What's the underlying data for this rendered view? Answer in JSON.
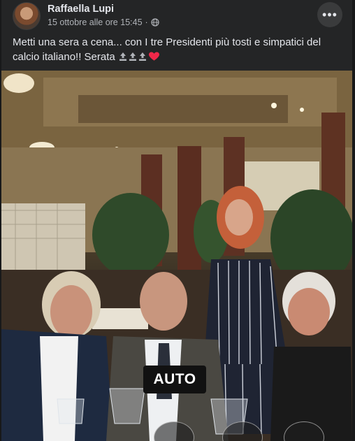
{
  "post": {
    "author": "Raffaella Lupi",
    "timestamp": "15 ottobre alle ore 15:45",
    "audience_icon": "globe-icon",
    "more_icon": "more-options-icon",
    "more_label": "•••",
    "caption_line1": "Metti una sera a cena... con I tre Presidenti più tosti e simpatici  del",
    "caption_line2_prefix": "calcio italiano!! Serata",
    "caption_emojis": [
      "top-arrow-emoji",
      "top-arrow-emoji",
      "top-arrow-emoji",
      "red-heart-emoji"
    ],
    "heart_color": "#f02849"
  },
  "photo": {
    "auto_label": "AUTO"
  },
  "colors": {
    "page_bg": "#18191a",
    "card_bg": "#242526",
    "text_primary": "#e4e6eb",
    "text_secondary": "#b0b3b8"
  }
}
